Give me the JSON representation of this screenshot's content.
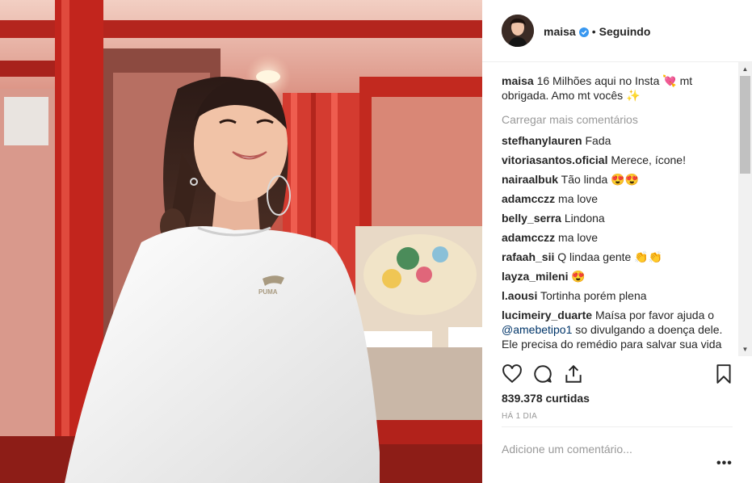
{
  "colors": {
    "text": "#262626",
    "muted": "#999999",
    "verified_blue": "#3897f0",
    "mention_blue": "#003569",
    "photo_red": "#c7463a"
  },
  "header": {
    "username": "maisa",
    "separator": "•",
    "follow_status": "Seguindo",
    "verified_icon": "verified-badge-icon"
  },
  "caption": {
    "user": "maisa",
    "text": "16 Milhões aqui no Insta 💘 mt obrigada. Amo mt vocês ✨"
  },
  "load_more": "Carregar mais comentários",
  "comments": [
    {
      "user": "stefhanylauren",
      "text": "Fada"
    },
    {
      "user": "vitoriasantos.oficial",
      "text": "Merece, ícone!"
    },
    {
      "user": "nairaalbuk",
      "text": "Tão linda 😍😍"
    },
    {
      "user": "adamcczz",
      "text": "ma love"
    },
    {
      "user": "belly_serra",
      "text": "Lindona"
    },
    {
      "user": "adamcczz",
      "text": "ma love"
    },
    {
      "user": "rafaah_sii",
      "text": "Q lindaa gente 👏👏"
    },
    {
      "user": "layza_mileni",
      "text": "😍"
    },
    {
      "user": "l.aousi",
      "text": "Tortinha porém plena"
    },
    {
      "user": "lucimeiry_duarte",
      "text": "Maísa por favor ajuda o",
      "mention": "@amebetipo1",
      "text_after": "so divulgando a doença dele. Ele precisa do remédio para salvar sua vida"
    }
  ],
  "actions": {
    "like_icon": "heart-icon",
    "comment_icon": "comment-icon",
    "share_icon": "share-icon",
    "save_icon": "bookmark-icon"
  },
  "likes": "839.378 curtidas",
  "time": "HÁ 1 DIA",
  "add_comment_placeholder": "Adicione um comentário...",
  "more_options": "•••"
}
